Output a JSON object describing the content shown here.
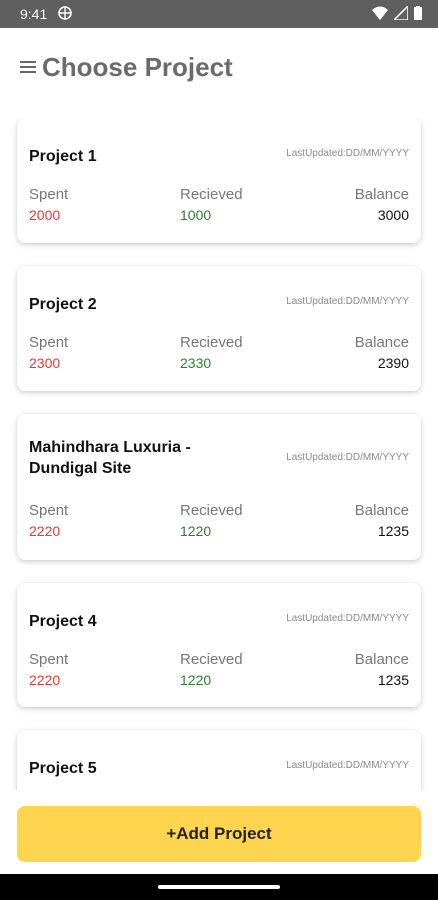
{
  "status_bar": {
    "time": "9:41"
  },
  "header": {
    "title": "Choose Project"
  },
  "projects": [
    {
      "name": "Project 1",
      "last_updated": "LastUpdated:DD/MM/YYYY",
      "spent_label": "Spent",
      "spent": "2000",
      "received_label": "Recieved",
      "received": "1000",
      "balance_label": "Balance",
      "balance": "3000"
    },
    {
      "name": "Project 2",
      "last_updated": "LastUpdated:DD/MM/YYYY",
      "spent_label": "Spent",
      "spent": "2300",
      "received_label": "Recieved",
      "received": "2330",
      "balance_label": "Balance",
      "balance": "2390"
    },
    {
      "name": "Mahindhara Luxuria -Dundigal Site",
      "last_updated": "LastUpdated:DD/MM/YYYY",
      "spent_label": "Spent",
      "spent": "2220",
      "received_label": "Recieved",
      "received": "1220",
      "balance_label": "Balance",
      "balance": "1235"
    },
    {
      "name": "Project 4",
      "last_updated": "LastUpdated:DD/MM/YYYY",
      "spent_label": "Spent",
      "spent": "2220",
      "received_label": "Recieved",
      "received": "1220",
      "balance_label": "Balance",
      "balance": "1235"
    },
    {
      "name": "Project 5",
      "last_updated": "LastUpdated:DD/MM/YYYY"
    }
  ],
  "add_button": {
    "label": "+Add Project"
  },
  "colors": {
    "spent": "#e53935",
    "received": "#2e7d32",
    "button": "#ffd54f"
  }
}
